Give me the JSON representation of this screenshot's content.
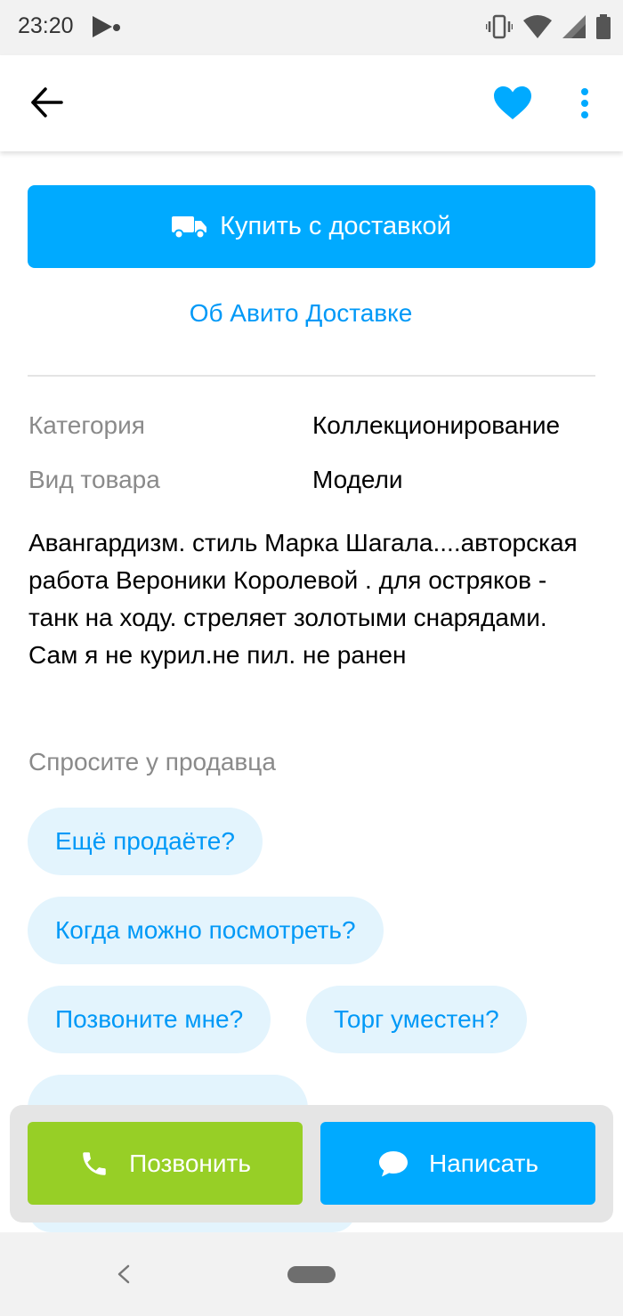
{
  "status_bar": {
    "time": "23:20",
    "icons": [
      "play-icon",
      "vibrate-icon",
      "wifi-icon",
      "signal-icon",
      "battery-icon"
    ]
  },
  "app_bar": {
    "icons": [
      "back-arrow-icon",
      "heart-icon",
      "more-vertical-icon"
    ],
    "favorite_color": "#00aaff"
  },
  "delivery": {
    "buy_label": "Купить с доставкой",
    "about_label": "Об Авито Доставке"
  },
  "params": [
    {
      "label": "Категория",
      "value": "Коллекционирование"
    },
    {
      "label": "Вид товара",
      "value": "Модели"
    }
  ],
  "description": "Авангардизм. стиль Марка Шагала....авторская работа Вероники Королевой . для остряков - танк на ходу. стреляет золотыми снарядами. Сам я не курил.не пил. не ранен",
  "ask_seller": {
    "title": "Спросите у продавца",
    "chips": [
      "Ещё продаёте?",
      "Когда можно посмотреть?",
      "Позвоните мне?",
      "Торг уместен?"
    ]
  },
  "actions": {
    "call_label": "Позвонить",
    "write_label": "Написать",
    "call_color": "#97cf26",
    "write_color": "#00aaff"
  }
}
